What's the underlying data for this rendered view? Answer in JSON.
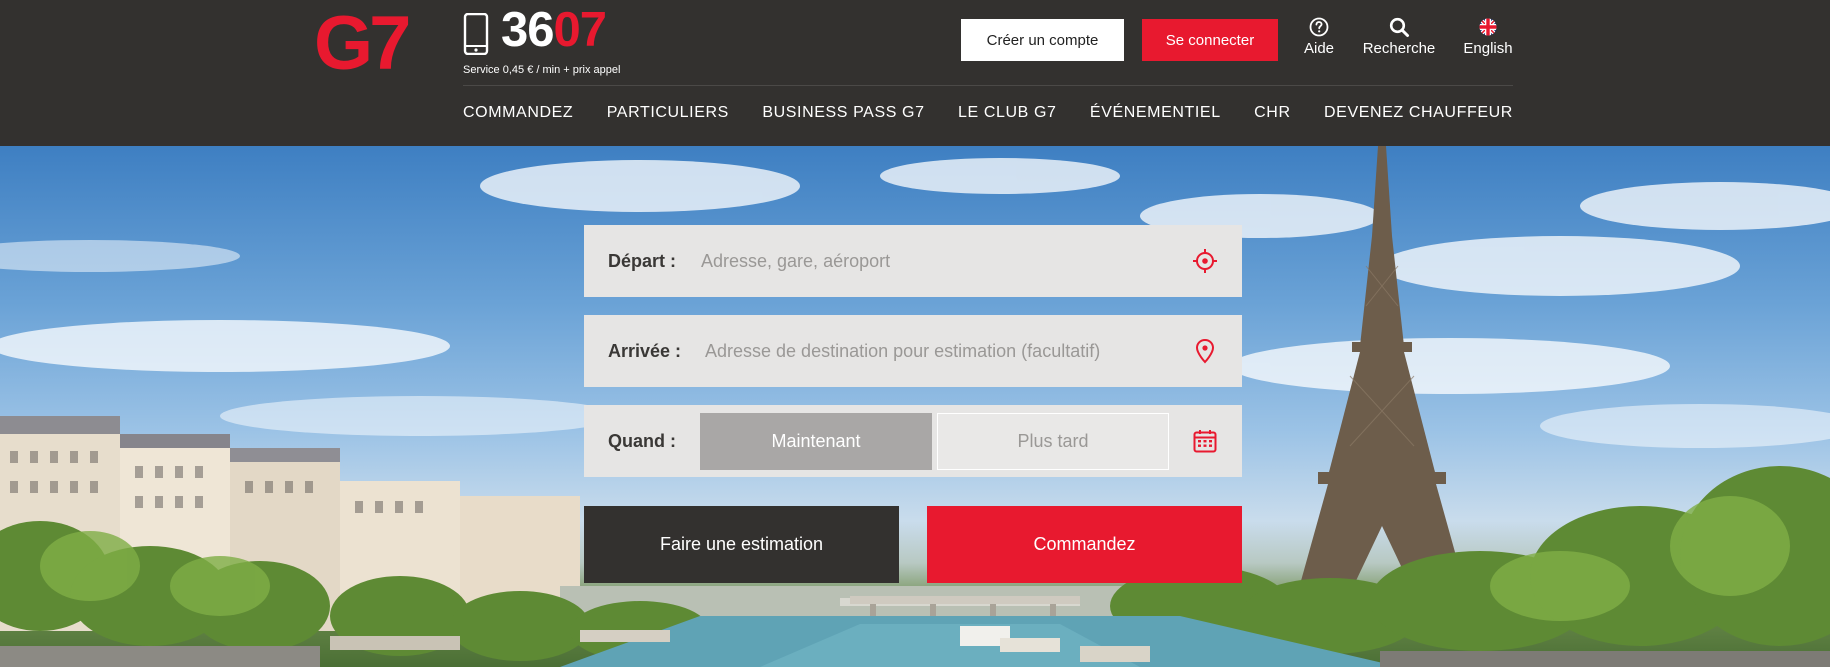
{
  "brand": {
    "logo_text": "G7",
    "phone_prefix": "36",
    "phone_suffix": "07",
    "phone_note": "Service 0,45 € / min + prix appel",
    "accent": "#e8192f",
    "header_bg": "#33312f"
  },
  "header": {
    "create_account": "Créer un compte",
    "login": "Se connecter",
    "help": "Aide",
    "search": "Recherche",
    "language": "English",
    "icons": [
      "question-icon",
      "search-icon",
      "uk-flag-icon"
    ]
  },
  "nav": {
    "items": [
      "COMMANDEZ",
      "PARTICULIERS",
      "BUSINESS PASS G7",
      "LE CLUB G7",
      "ÉVÉNEMENTIEL",
      "CHR",
      "DEVENEZ CHAUFFEUR"
    ]
  },
  "booking": {
    "depart_label": "Départ :",
    "depart_placeholder": "Adresse, gare, aéroport",
    "arrivee_label": "Arrivée :",
    "arrivee_placeholder": "Adresse de destination pour estimation (facultatif)",
    "quand_label": "Quand :",
    "now": "Maintenant",
    "later": "Plus tard",
    "selected_when": "Maintenant",
    "estimate_button": "Faire une estimation",
    "order_button": "Commandez"
  }
}
